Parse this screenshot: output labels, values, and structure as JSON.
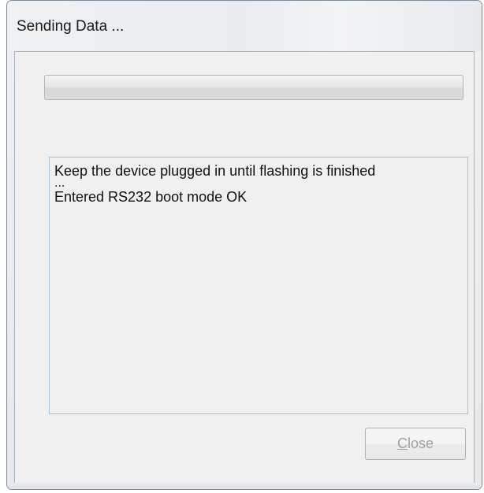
{
  "window": {
    "title": "Sending Data ..."
  },
  "progress": {
    "value_fraction": 0.0
  },
  "log": {
    "lines": [
      "Keep the device plugged in until flashing is finished",
      "...",
      "Entered RS232 boot mode OK"
    ]
  },
  "buttons": {
    "close_mnemonic": "C",
    "close_rest": "lose",
    "close_enabled": false
  },
  "colors": {
    "window_bg": "#e6e8eb",
    "client_bg": "#f0f0f0",
    "log_border": "#a7bfd2",
    "disabled_text": "#a0a0a0"
  }
}
